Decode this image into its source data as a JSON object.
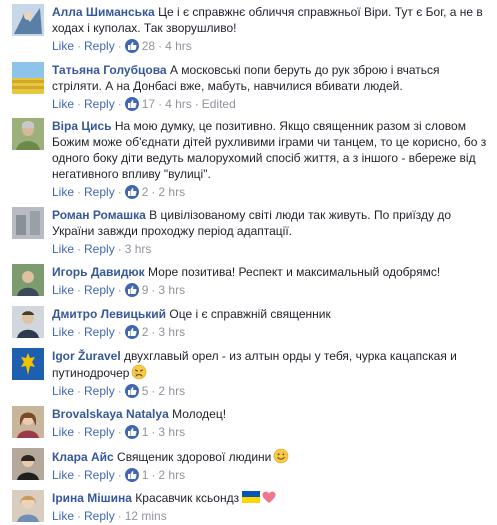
{
  "comments": [
    {
      "author": "Алла Шиманська",
      "text": "Це і є справжнє обличчя справжньої Віри. Тут є Бог, а не в ходах і куполах. Так зворушливо!",
      "like_label": "Like",
      "reply_label": "Reply",
      "like_count": "28",
      "time": "4 hrs",
      "edited": ""
    },
    {
      "author": "Татьяна Голубцова",
      "text": "А московські попи беруть до рук зброю і вчаться стріляти. А на Донбасі вже, мабуть, навчилися вбивати людей.",
      "like_label": "Like",
      "reply_label": "Reply",
      "like_count": "17",
      "time": "4 hrs",
      "edited": "Edited"
    },
    {
      "author": "Віра Цись",
      "text": "На мою думку, це позитивно. Якщо священник разом зі словом Божим може об'єднати дітей рухливими іграми чи танцем, то це корисно, бо з одного боку діти ведуть малорухомий спосіб життя, а з іншого - вбереже від негативного впливу \"вулиці\".",
      "like_label": "Like",
      "reply_label": "Reply",
      "like_count": "2",
      "time": "2 hrs",
      "edited": ""
    },
    {
      "author": "Роман Ромашка",
      "text": "В цивілізованому світі люди так живуть. По приїзду до України завжди проходжу період адаптації.",
      "like_label": "Like",
      "reply_label": "Reply",
      "like_count": "",
      "time": "3 hrs",
      "edited": ""
    },
    {
      "author": "Игорь Давидюк",
      "text": "Море позитива! Респект и максимальный одобрямс!",
      "like_label": "Like",
      "reply_label": "Reply",
      "like_count": "9",
      "time": "3 hrs",
      "edited": ""
    },
    {
      "author": "Дмитро Левицький",
      "text": "Оце і є справжній священник",
      "like_label": "Like",
      "reply_label": "Reply",
      "like_count": "2",
      "time": "3 hrs",
      "edited": ""
    },
    {
      "author": "Igor Žuravel",
      "text": "двухглавый орел - из алтын орды у тебя, чурка кацапская и путинодрочер",
      "like_label": "Like",
      "reply_label": "Reply",
      "like_count": "5",
      "time": "2 hrs",
      "edited": ""
    },
    {
      "author": "Brovalskaya Natalya",
      "text": "Молодец!",
      "like_label": "Like",
      "reply_label": "Reply",
      "like_count": "1",
      "time": "3 hrs",
      "edited": ""
    },
    {
      "author": "Клара Айс",
      "text": "Священик здорової людини",
      "like_label": "Like",
      "reply_label": "Reply",
      "like_count": "1",
      "time": "2 hrs",
      "edited": ""
    },
    {
      "author": "Ірина Мішина",
      "text": "Красавчик ксьондз",
      "like_label": "Like",
      "reply_label": "Reply",
      "like_count": "",
      "time": "12 mins",
      "edited": ""
    }
  ],
  "icons": {
    "like": "thumbs-up-icon",
    "sad": "crying-face-emoji",
    "smile": "smiling-face-emoji",
    "flag": "ukraine-flag-emoji",
    "heart": "pink-heart-emoji"
  },
  "colors": {
    "author": "#365899",
    "link": "#4267b2",
    "meta": "#90949c",
    "like_badge": "#4267b2"
  }
}
